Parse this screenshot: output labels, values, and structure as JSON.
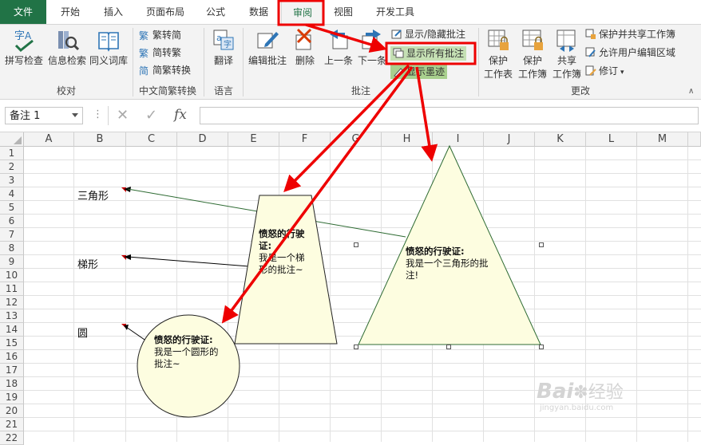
{
  "tabs": [
    {
      "label": "文件",
      "kind": "file"
    },
    {
      "label": "开始"
    },
    {
      "label": "插入"
    },
    {
      "label": "页面布局"
    },
    {
      "label": "公式"
    },
    {
      "label": "数据"
    },
    {
      "label": "审阅",
      "active": true
    },
    {
      "label": "视图"
    },
    {
      "label": "开发工具"
    }
  ],
  "ribbon": {
    "proofing": {
      "group": "校对",
      "spell": "拼写检查",
      "research": "信息检索",
      "thesaurus": "同义词库"
    },
    "chinese": {
      "group": "中文简繁转换",
      "to_simplified": "繁转简",
      "to_traditional": "简转繁",
      "convert": "简繁转换"
    },
    "language": {
      "group": "语言",
      "translate": "翻译"
    },
    "comments": {
      "group": "批注",
      "edit": "编辑批注",
      "delete": "删除",
      "prev": "上一条",
      "next": "下一条",
      "show_hide": "显示/隐藏批注",
      "show_all": "显示所有批注",
      "show_ink": "显示墨迹"
    },
    "changes": {
      "group": "更改",
      "protect_sheet_1": "保护",
      "protect_sheet_2": "工作表",
      "protect_book_1": "保护",
      "protect_book_2": "工作簿",
      "share_1": "共享",
      "share_2": "工作簿",
      "protect_share": "保护并共享工作簿",
      "allow_edit": "允许用户编辑区域",
      "track": "修订"
    }
  },
  "formula_bar": {
    "name_box": "备注 1",
    "cancel": "✕",
    "enter": "✓",
    "fx": "fx",
    "value": ""
  },
  "columns": [
    "A",
    "B",
    "C",
    "D",
    "E",
    "F",
    "G",
    "H",
    "I",
    "J",
    "K",
    "L",
    "M"
  ],
  "rows": [
    "1",
    "2",
    "3",
    "4",
    "5",
    "6",
    "7",
    "8",
    "9",
    "10",
    "11",
    "12",
    "13",
    "14",
    "15",
    "16",
    "17",
    "18",
    "19",
    "20",
    "21",
    "22"
  ],
  "cells": {
    "b4": "三角形",
    "b9": "梯形",
    "b14": "圆"
  },
  "notes": {
    "trapezoid": {
      "author": "愤怒的行驶证:",
      "body_1": "我是一个梯",
      "body_2": "形的批注~"
    },
    "triangle": {
      "author": "愤怒的行驶证:",
      "body_1": "我是一个三角形的批",
      "body_2": "注!"
    },
    "circle": {
      "author": "愤怒的行驶证:",
      "body_1": "我是一个圆形的",
      "body_2": "批注~"
    }
  },
  "watermark": {
    "brand": "Bai",
    "brand2": "经验",
    "site": "jingyan.baidu.com"
  },
  "colors": {
    "excel_green": "#217346",
    "note_fill": "#fdfde0",
    "arrow_red": "#ee0000"
  }
}
